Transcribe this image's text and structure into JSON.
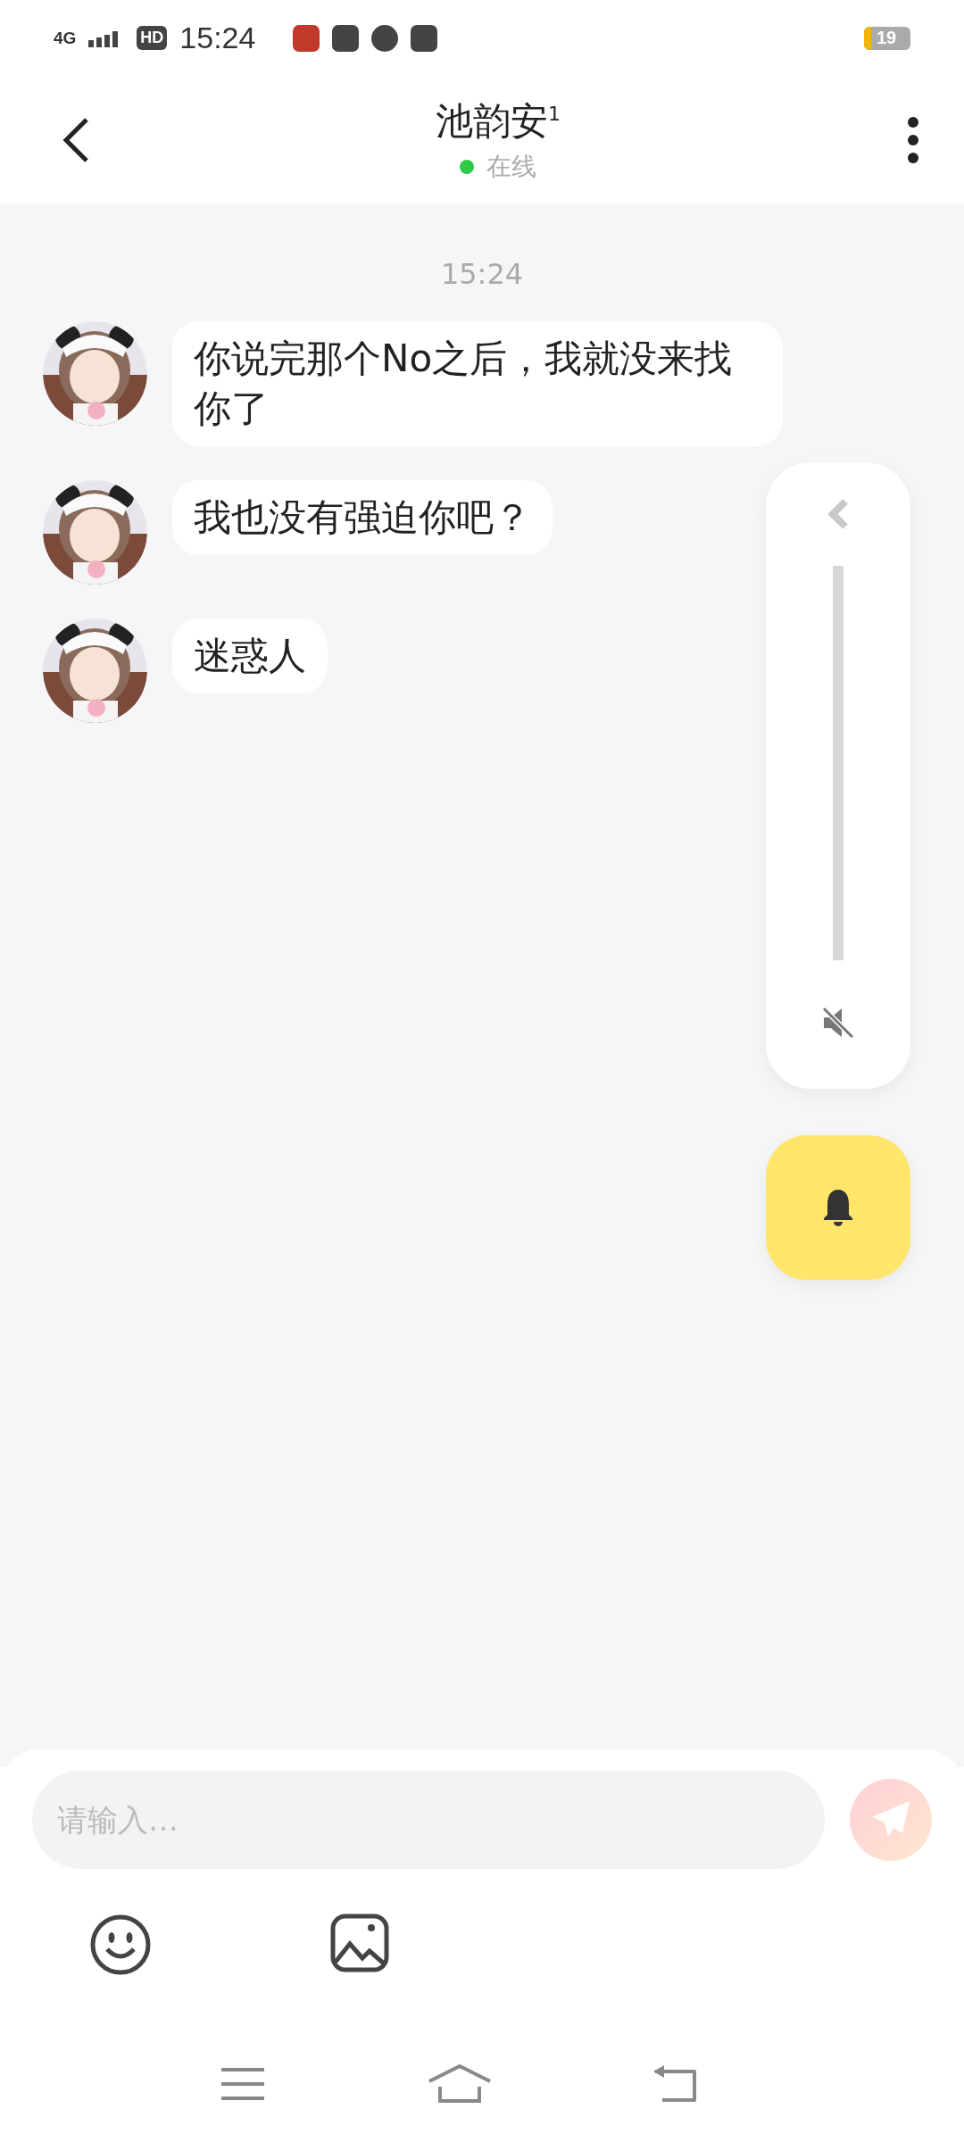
{
  "status_bar": {
    "network": "4G",
    "hd": "HD",
    "time": "15:24",
    "battery": "19"
  },
  "header": {
    "title": "池韵安$^{1}$",
    "status": "在线"
  },
  "timestamp": "15:24",
  "messages": [
    {
      "text": "你说完那个No之后，我就没来找你了"
    },
    {
      "text": "我也没有强迫你吧？"
    },
    {
      "text": "迷惑人"
    }
  ],
  "volume_panel": {
    "level": 0,
    "muted": true
  },
  "input": {
    "placeholder": "请输入…"
  }
}
